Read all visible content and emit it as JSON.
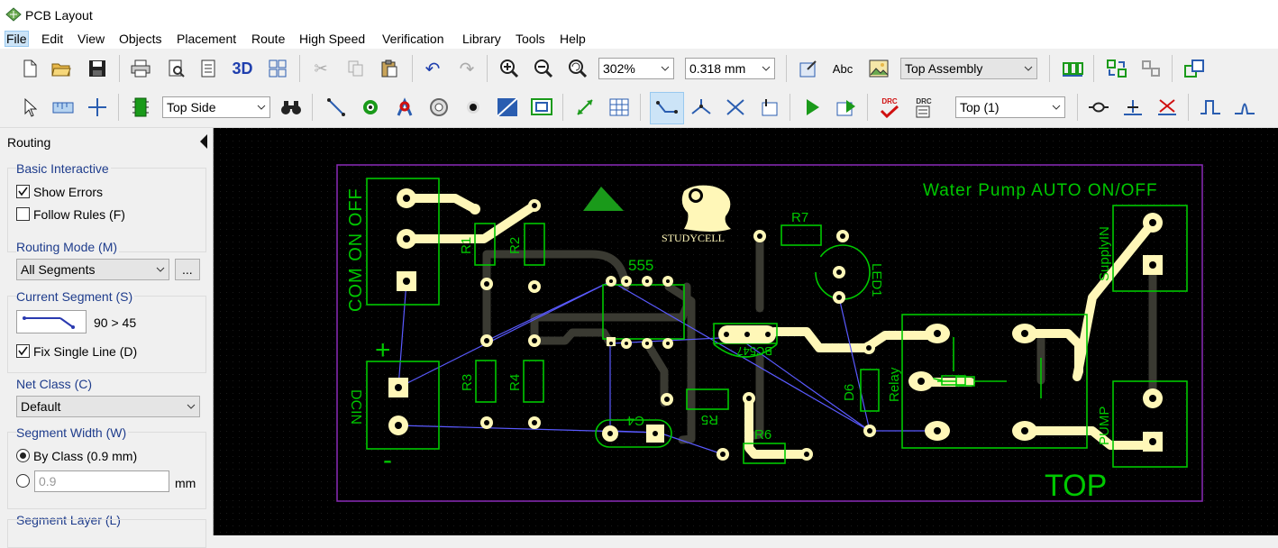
{
  "window": {
    "title": "PCB Layout"
  },
  "menu": [
    "File",
    "Edit",
    "View",
    "Objects",
    "Placement",
    "Route",
    "High Speed",
    "Verification",
    "Library",
    "Tools",
    "Help"
  ],
  "toolbar1": {
    "zoom": "302%",
    "grid": "0.318 mm",
    "view_mode": "Top Assembly",
    "text_tool": "Abc"
  },
  "toolbar2": {
    "side": "Top Side",
    "layer": "Top (1)",
    "drc1": "DRC",
    "drc2": "DRC"
  },
  "panel": {
    "title": "Routing",
    "basic_interactive": "Basic Interactive",
    "show_errors": "Show Errors",
    "follow_rules": "Follow Rules (F)",
    "routing_mode_label": "Routing Mode (M)",
    "routing_mode": "All Segments",
    "more_button": "...",
    "current_segment_label": "Current Segment (S)",
    "segment_angle": "90 > 45",
    "fix_single_line": "Fix Single Line (D)",
    "net_class_label": "Net Class (C)",
    "net_class": "Default",
    "segment_width_label": "Segment Width (W)",
    "by_class": "By Class  (0.9 mm)",
    "custom_width": "0.9",
    "unit": "mm",
    "segment_layer_label": "Segment Layer (L)"
  },
  "board": {
    "title": "Water Pump AUTO ON/OFF",
    "layer_text": "TOP",
    "logo_text": "STUDYCELL",
    "connector_left": "COM ON OFF",
    "plus": "+",
    "minus": "-",
    "dcin": "DCIN",
    "refs": {
      "r1": "R1",
      "r2": "R2",
      "r3": "R3",
      "r4": "R4",
      "r5": "R5",
      "r6": "R6",
      "r7": "R7",
      "ic": "555",
      "c4": "C4",
      "q": "BC547",
      "led": "LED1",
      "d6": "D6",
      "relay": "Relay",
      "supply": "SupplyIN",
      "pump": "PUMP"
    }
  },
  "colors": {
    "silk": "#00c800",
    "trace_top": "#fff7b8",
    "trace_bottom": "#3a3a32",
    "ratsnest": "#5a5aff",
    "outline": "#8a2bb8"
  }
}
